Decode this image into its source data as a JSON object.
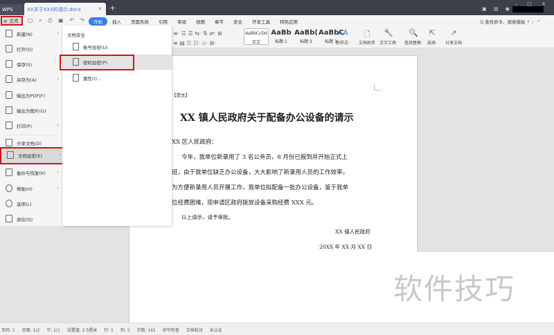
{
  "titlebar": {
    "app": "WPS",
    "doc_tab": "XX关于XXX的请示.docx",
    "new_tab": "+",
    "window_controls": "– □ ✕"
  },
  "menubar": {
    "file": "≡ 文件",
    "items": [
      "开始",
      "插入",
      "页面布局",
      "引用",
      "审阅",
      "视图",
      "章节",
      "安全",
      "开发工具",
      "特色应用"
    ],
    "search": "Q 查找命令、搜索模板  ?  ⋮  ⌃"
  },
  "ribbon": {
    "styles": [
      {
        "preview": "AaBbCcDd",
        "label": "正文"
      },
      {
        "preview": "AaBb",
        "label": "标题 1"
      },
      {
        "preview": "AaBb(",
        "label": "标题 2"
      },
      {
        "preview": "AaBbC",
        "label": "标题 3"
      }
    ],
    "buttons": [
      {
        "icon": "AA",
        "label": "新样式·"
      },
      {
        "icon": "🗋",
        "label": "文档助手"
      },
      {
        "icon": "🔧",
        "label": "文字工具·"
      },
      {
        "icon": "🔍",
        "label": "查找替换·"
      },
      {
        "icon": "⇱",
        "label": "选择·"
      },
      {
        "icon": "↗",
        "label": "分享文档"
      }
    ]
  },
  "file_menu": {
    "items": [
      {
        "label": "新建(N)",
        "arrow": true
      },
      {
        "label": "打开(O)"
      },
      {
        "label": "保存(S)"
      },
      {
        "label": "另存为(A)",
        "arrow": true
      },
      {
        "label": "输出为PDF(F)"
      },
      {
        "label": "输出为图片(G)"
      },
      {
        "label": "打印(P)",
        "arrow": true
      },
      {
        "label": "分享文档(D)"
      },
      {
        "label": "文档加密(E)",
        "arrow": true
      },
      {
        "label": "备份与恢复(K)",
        "arrow": true
      },
      {
        "label": "帮助(H)",
        "arrow": true
      },
      {
        "label": "选项(L)"
      },
      {
        "label": "退出(Q)"
      }
    ]
  },
  "submenu": {
    "header": "文档安全",
    "items": [
      "账号加密(U)",
      "密码加密(P)",
      "属性(I)..."
    ]
  },
  "document": {
    "tag": "【范文】",
    "title": "XX 镇人民政府关于配备办公设备的请示",
    "salutation": "XX 区人民政府：",
    "lines": [
      "今年，我单位新录用了 3 名公务员，8 月份已报到并开始正式上",
      "班，由于我单位缺乏办公设备，大大影响了新录用人员的工作效率，",
      "为方便新录用人员开展工作，我单位拟配备一批办公设备，鉴于我单",
      "位经费困难，现申请区政府拨放设备采购经费 XXX 元。"
    ],
    "closing": "以上请示，请予审批。",
    "signature": "XX 镇人民政府",
    "date": "20XX 年 XX 月 XX 日"
  },
  "watermark": "软件技巧",
  "statusbar": [
    "页码: 1",
    "页面: 1/2",
    "节: 1/1",
    "设置值: 2.5厘米",
    "行: 1",
    "列: 5",
    "字数: 161",
    "拼写检查",
    "文档校对",
    "未认证"
  ]
}
